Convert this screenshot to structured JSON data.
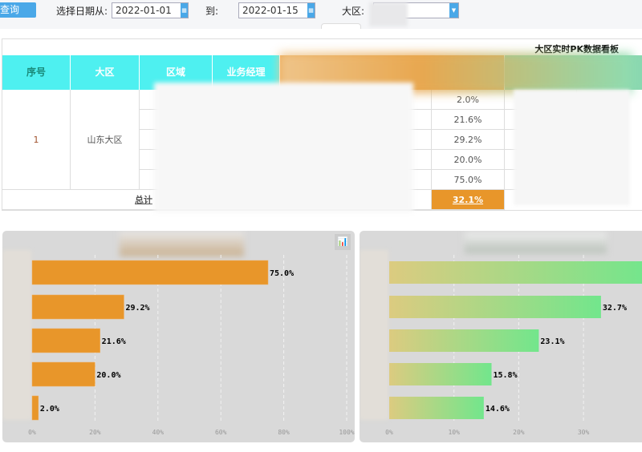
{
  "toolbar": {
    "query_button": "查询",
    "date_from_label": "选择日期从:",
    "date_from": "2022-01-01",
    "date_to_label": "到:",
    "date_to": "2022-01-15",
    "region_label": "大区:",
    "calendar_icon": "calendar-icon",
    "dropdown_icon": "chevron-down-icon"
  },
  "table": {
    "title": "大区实时PK数据看板",
    "headers": [
      "序号",
      "大区",
      "区域",
      "业务经理"
    ],
    "row": {
      "index": "1",
      "region": "山东大区"
    },
    "rates": [
      "2.0%",
      "21.6%",
      "29.2%",
      "20.0%",
      "75.0%"
    ],
    "total_label": "总计",
    "total_rate": "32.1%"
  },
  "colors": {
    "cyan": "#4ef0f0",
    "orange": "#e8962a",
    "green": "#72e68c",
    "blue": "#4aa8e8"
  },
  "chart_data": [
    {
      "type": "bar",
      "orientation": "horizontal",
      "values": [
        75.0,
        29.2,
        21.6,
        20.0,
        2.0
      ],
      "labels": [
        "75.0%",
        "29.2%",
        "21.6%",
        "20.0%",
        "2.0%"
      ],
      "xticks": [
        "0%",
        "20%",
        "40%",
        "60%",
        "80%",
        "100%"
      ],
      "xlim": [
        0,
        100
      ],
      "color": "#e8962a",
      "grid": true
    },
    {
      "type": "bar",
      "orientation": "horizontal",
      "values": [
        40,
        32.7,
        23.1,
        15.8,
        14.6
      ],
      "labels": [
        "",
        "32.7%",
        "23.1%",
        "15.8%",
        "14.6%"
      ],
      "xticks": [
        "0%",
        "10%",
        "20%",
        "30%"
      ],
      "xlim": [
        0,
        39.2
      ],
      "gradient": [
        "#dccb80",
        "#72e68c"
      ],
      "grid": true
    }
  ]
}
